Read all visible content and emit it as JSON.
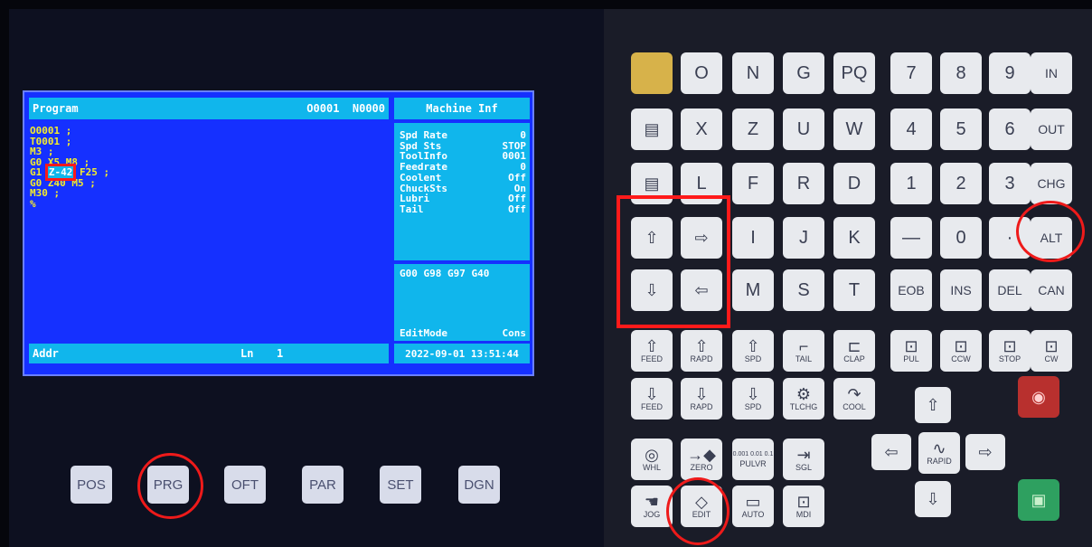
{
  "screen": {
    "title": "Program",
    "prog_no": "O0001",
    "seq_no": "N0000",
    "machine_title": "Machine Inf",
    "program_lines": [
      {
        "before": "O0001 ;",
        "hl": "",
        "after": ""
      },
      {
        "before": "T0001 ;",
        "hl": "",
        "after": ""
      },
      {
        "before": "M3 ;",
        "hl": "",
        "after": ""
      },
      {
        "before": "G0 X5 M8 ;",
        "hl": "",
        "after": ""
      },
      {
        "before": "G1 ",
        "hl": "Z-42",
        "after": " F25 ;"
      },
      {
        "before": "G0 Z40 M5 ;",
        "hl": "",
        "after": ""
      },
      {
        "before": "M30 ;",
        "hl": "",
        "after": ""
      },
      {
        "before": "%",
        "hl": "",
        "after": ""
      }
    ],
    "machine_info": [
      {
        "label": "Spd Rate",
        "value": "0"
      },
      {
        "label": "Spd Sts",
        "value": "STOP"
      },
      {
        "label": "ToolInfo",
        "value": "0001"
      },
      {
        "label": "Feedrate",
        "value": "0"
      },
      {
        "label": "Coolent",
        "value": "Off"
      },
      {
        "label": "ChuckSts",
        "value": "On"
      },
      {
        "label": "Lubri",
        "value": "Off"
      },
      {
        "label": "Tail",
        "value": "Off"
      }
    ],
    "gcodes": "G00 G98 G97 G40",
    "edit_mode": "EditMode",
    "cons": "Cons",
    "addr_label": "Addr",
    "ln_label": "Ln",
    "ln_value": "1",
    "datetime": "2022-09-01 13:51:44"
  },
  "soft_keys": [
    "POS",
    "PRG",
    "OFT",
    "PAR",
    "SET",
    "DGN"
  ],
  "keypad": {
    "row1": [
      "O",
      "N",
      "G",
      "PQ",
      "7",
      "8",
      "9",
      "IN"
    ],
    "row2": [
      "X",
      "Z",
      "U",
      "W",
      "4",
      "5",
      "6",
      "OUT"
    ],
    "row3": [
      "L",
      "F",
      "R",
      "D",
      "1",
      "2",
      "3",
      "CHG"
    ],
    "row4": [
      "I",
      "J",
      "K",
      "—",
      "0",
      "·",
      "ALT"
    ],
    "row5": [
      "M",
      "S",
      "T",
      "EOB",
      "INS",
      "DEL",
      "CAN"
    ],
    "func_row1": [
      "FEED",
      "RAPD",
      "SPD",
      "TAIL",
      "CLAP",
      "PUL",
      "CCW",
      "STOP",
      "CW"
    ],
    "func_row2": [
      "FEED",
      "RAPD",
      "SPD",
      "TLCHG",
      "COOL"
    ],
    "mode_row1": [
      "WHL",
      "ZERO",
      "PULVR",
      "SGL"
    ],
    "mode_row2": [
      "JOG",
      "EDIT",
      "AUTO",
      "MDI"
    ],
    "rapid": "RAPID",
    "pulvr_values": "0.001 0.01 0.1"
  }
}
